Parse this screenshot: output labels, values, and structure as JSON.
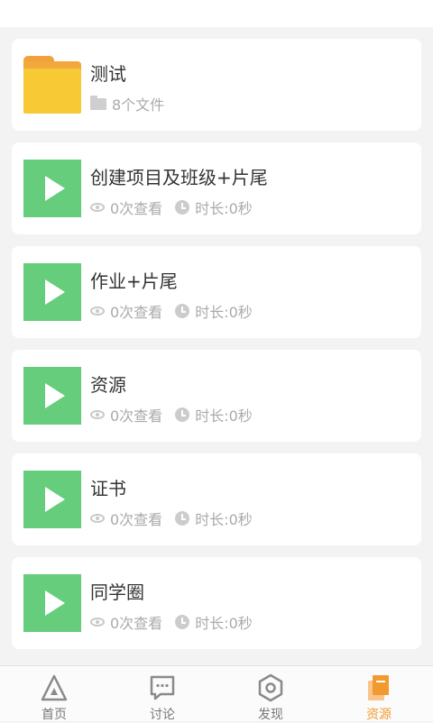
{
  "folder": {
    "title": "测试",
    "file_count": "8个文件"
  },
  "videos": [
    {
      "title": "创建项目及班级+片尾",
      "views": "0次查看",
      "duration": "时长:0秒"
    },
    {
      "title": "作业+片尾",
      "views": "0次查看",
      "duration": "时长:0秒"
    },
    {
      "title": "资源",
      "views": "0次查看",
      "duration": "时长:0秒"
    },
    {
      "title": "证书",
      "views": "0次查看",
      "duration": "时长:0秒"
    },
    {
      "title": "同学圈",
      "views": "0次查看",
      "duration": "时长:0秒"
    }
  ],
  "tabbar": {
    "items": [
      {
        "label": "首页",
        "icon": "home-triangle-icon"
      },
      {
        "label": "讨论",
        "icon": "discussion-icon"
      },
      {
        "label": "发现",
        "icon": "discover-hexagon-icon"
      },
      {
        "label": "资源",
        "icon": "resources-icon"
      }
    ],
    "active_index": 3
  },
  "colors": {
    "accent": "#f29a2e",
    "video_thumb": "#65cd7b",
    "folder": "#f7c935"
  }
}
